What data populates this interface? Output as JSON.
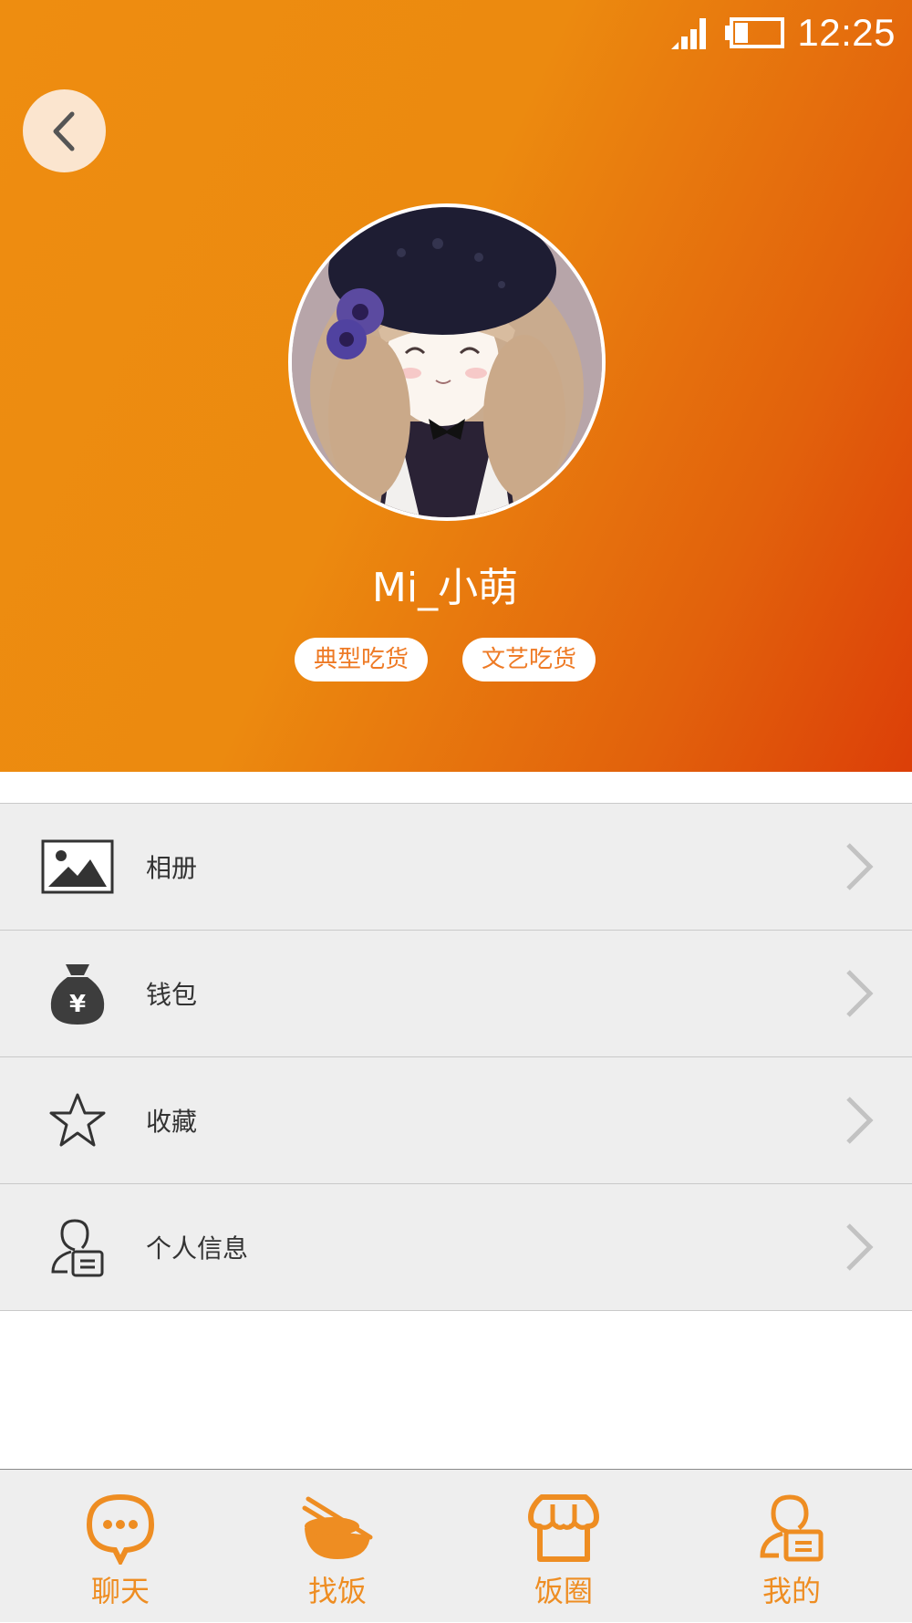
{
  "status_bar": {
    "time": "12:25",
    "signal_icon": "signal-icon",
    "battery_icon": "battery-icon"
  },
  "header": {
    "back_icon": "chevron-left-icon",
    "username": "Mi_小萌",
    "tags": [
      "典型吃货",
      "文艺吃货"
    ]
  },
  "menu": {
    "items": [
      {
        "label": "相册",
        "icon": "image-icon"
      },
      {
        "label": "钱包",
        "icon": "money-bag-icon"
      },
      {
        "label": "收藏",
        "icon": "star-icon"
      },
      {
        "label": "个人信息",
        "icon": "user-card-icon"
      }
    ]
  },
  "tabbar": {
    "tabs": [
      {
        "label": "聊天",
        "icon": "chat-bubble-icon"
      },
      {
        "label": "找饭",
        "icon": "rice-bowl-icon"
      },
      {
        "label": "饭圈",
        "icon": "storefront-icon"
      },
      {
        "label": "我的",
        "icon": "user-card-icon"
      }
    ]
  },
  "colors": {
    "accent": "#ee8d22",
    "header_start": "#ee8d10",
    "header_end": "#dc3f08",
    "menu_bg": "#eeeeee"
  }
}
